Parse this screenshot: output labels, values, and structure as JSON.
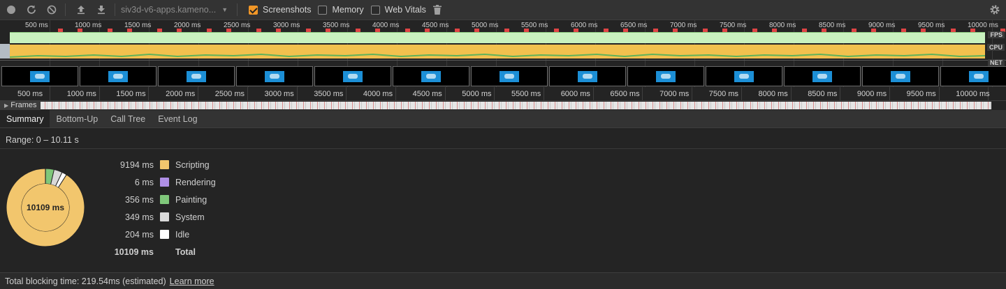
{
  "toolbar": {
    "recording_url": "siv3d-v6-apps.kameno...",
    "screenshots_label": "Screenshots",
    "screenshots_checked": true,
    "memory_label": "Memory",
    "memory_checked": false,
    "webvitals_label": "Web Vitals",
    "webvitals_checked": false,
    "icons": [
      "record-icon",
      "reload-icon",
      "clear-icon",
      "upload-icon",
      "download-icon",
      "trash-icon",
      "gear-icon"
    ]
  },
  "overview": {
    "ticks": [
      "500 ms",
      "1000 ms",
      "1500 ms",
      "2000 ms",
      "2500 ms",
      "3000 ms",
      "3500 ms",
      "4000 ms",
      "4500 ms",
      "5000 ms",
      "5500 ms",
      "6000 ms",
      "6500 ms",
      "7000 ms",
      "7500 ms",
      "8000 ms",
      "8500 ms",
      "9000 ms",
      "9500 ms",
      "10000 ms"
    ],
    "fps_label": "FPS",
    "cpu_label": "CPU",
    "net_label": "NET",
    "screenshot_count": 13
  },
  "timeline": {
    "ticks": [
      "500 ms",
      "1000 ms",
      "1500 ms",
      "2000 ms",
      "2500 ms",
      "3000 ms",
      "3500 ms",
      "4000 ms",
      "4500 ms",
      "5000 ms",
      "5500 ms",
      "6000 ms",
      "6500 ms",
      "7000 ms",
      "7500 ms",
      "8000 ms",
      "8500 ms",
      "9000 ms",
      "9500 ms",
      "10000 ms",
      "1"
    ],
    "frames_label": "Frames"
  },
  "tabs": [
    "Summary",
    "Bottom-Up",
    "Call Tree",
    "Event Log"
  ],
  "active_tab": "Summary",
  "summary": {
    "range": "Range: 0 – 10.11 s",
    "total_center": "10109 ms",
    "items": [
      {
        "value": "9194 ms",
        "label": "Scripting",
        "color": "#f2c66d",
        "ms": 9194
      },
      {
        "value": "6 ms",
        "label": "Rendering",
        "color": "#af8fe6",
        "ms": 6
      },
      {
        "value": "356 ms",
        "label": "Painting",
        "color": "#7fc77a",
        "ms": 356
      },
      {
        "value": "349 ms",
        "label": "System",
        "color": "#d9d9d9",
        "ms": 349
      },
      {
        "value": "204 ms",
        "label": "Idle",
        "color": "#ffffff",
        "ms": 204
      }
    ],
    "total_value": "10109 ms",
    "total_label": "Total"
  },
  "footer": {
    "text": "Total blocking time: 219.54ms (estimated)",
    "link": "Learn more"
  }
}
